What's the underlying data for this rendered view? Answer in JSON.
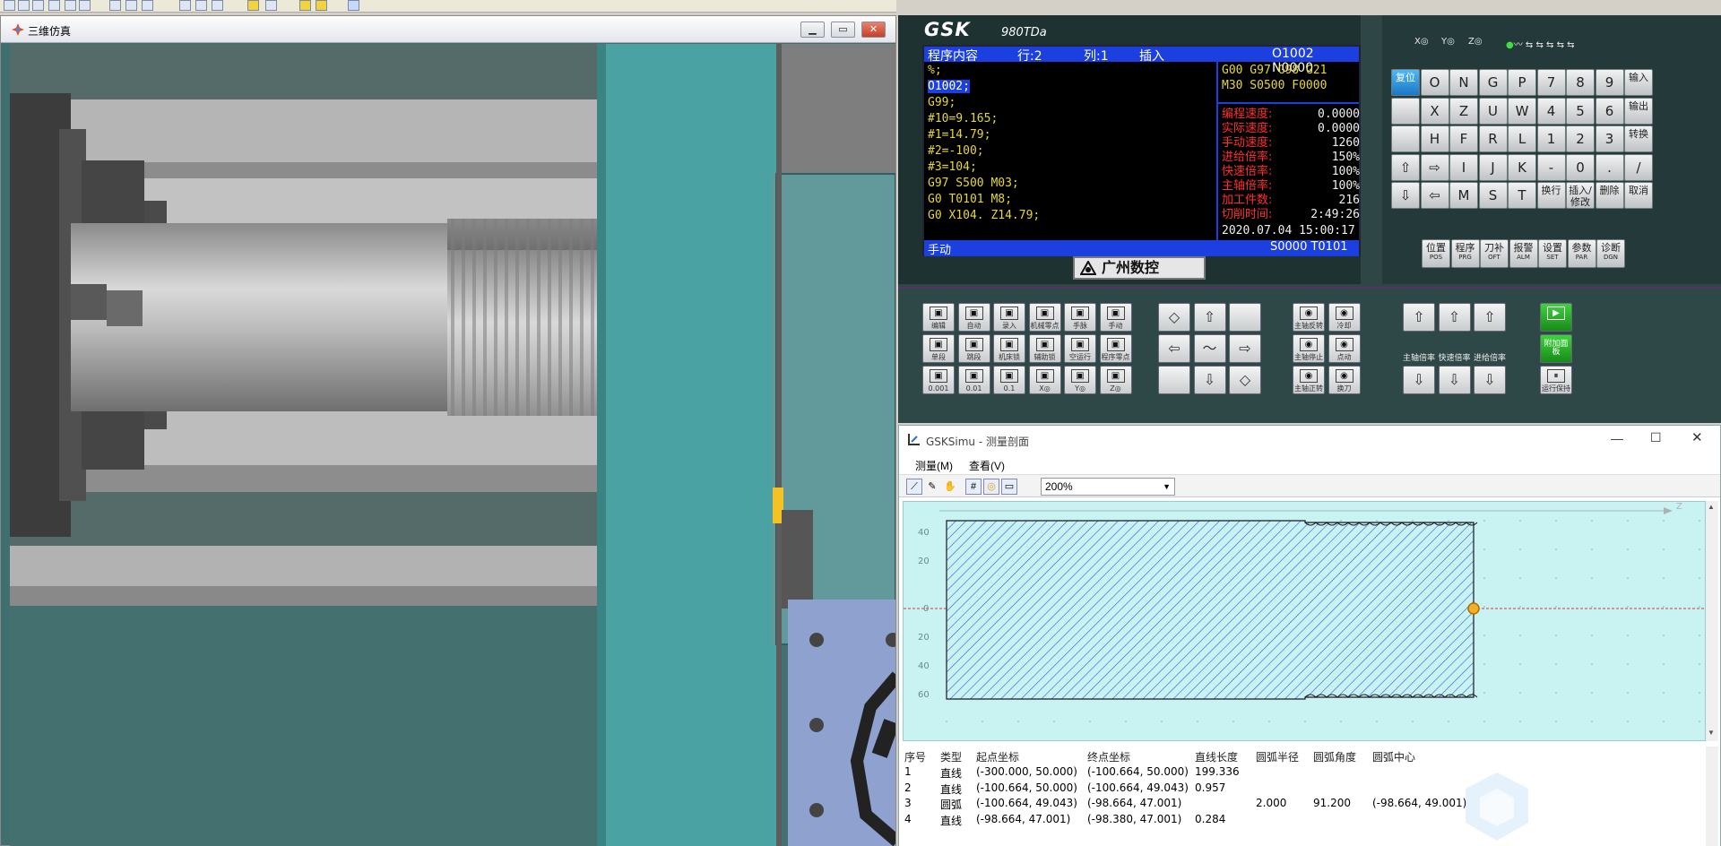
{
  "sim3d": {
    "title": "三维仿真"
  },
  "cnc": {
    "logo": "GSK",
    "model": "980TDa",
    "brand": "广州数控",
    "header": {
      "content": "程序内容",
      "row": "行:2",
      "col": "列:1",
      "mode": "插入",
      "program": "O1002 N0000"
    },
    "program_lines": [
      "%;",
      "O1002;",
      "G99;",
      "#10=9.165;",
      "#1=14.79;",
      "#2=-100;",
      "#3=104;",
      "G97 S500 M03;",
      "G0 T0101 M8;",
      "G0 X104. Z14.79;"
    ],
    "selected_line_index": 1,
    "mcodes": [
      "G00 G97 G98 G21",
      "M30 S0500 F0000"
    ],
    "status": [
      {
        "label": "编程速度:",
        "value": "0.0000"
      },
      {
        "label": "实际速度:",
        "value": "0.0000"
      },
      {
        "label": "手动速度:",
        "value": "1260"
      },
      {
        "label": "进给倍率:",
        "value": "150%"
      },
      {
        "label": "快速倍率:",
        "value": "100%"
      },
      {
        "label": "主轴倍率:",
        "value": "100%"
      },
      {
        "label": "加工件数:",
        "value": "216"
      },
      {
        "label": "切削时间:",
        "value": "2:49:26"
      }
    ],
    "datetime": "2020.07.04 15:00:17",
    "footer": {
      "mode": "手动",
      "spindle": "S0000 T0101"
    },
    "indicators": [
      "X◎",
      "Y◎",
      "Z◎"
    ],
    "keys": {
      "row1": [
        "复位",
        "O",
        "N",
        "G",
        "P",
        "7",
        "8",
        "9",
        "输入"
      ],
      "row2": [
        "",
        "X",
        "Z",
        "U",
        "W",
        "4",
        "5",
        "6",
        "输出"
      ],
      "row3": [
        "",
        "H",
        "F",
        "R",
        "L",
        "1",
        "2",
        "3",
        "转换"
      ],
      "row4": [
        "⇧",
        "⇨",
        "I",
        "J",
        "K",
        "-",
        "0",
        ".",
        "/"
      ],
      "row5": [
        "⇩",
        "⇦",
        "M",
        "S",
        "T",
        "换行",
        "插入/修改",
        "删除",
        "取消"
      ],
      "row6": [
        "位置",
        "程序",
        "刀补",
        "报警",
        "设置",
        "参数",
        "诊断"
      ],
      "row6_sub": [
        "POS",
        "PRG",
        "OFT",
        "ALM",
        "SET",
        "PAR",
        "DGN"
      ]
    },
    "ops": {
      "row1": [
        "编辑",
        "自动",
        "录入",
        "机械零点",
        "手脉",
        "手动"
      ],
      "row2": [
        "单段",
        "跳段",
        "机床锁",
        "辅助锁",
        "空运行",
        "程序零点"
      ],
      "row3": [
        "0.001",
        "0.01",
        "0.1",
        "X◎",
        "Y◎",
        "Z◎"
      ],
      "spindle": [
        "主轴反转",
        "冷却",
        "主轴停止",
        "点动",
        "主轴正转",
        "换刀"
      ],
      "override_labels": [
        "主轴倍率",
        "快速倍率",
        "进给倍率"
      ],
      "extra": [
        "附加面板",
        "运行保持"
      ]
    }
  },
  "measure": {
    "title": "GSKSimu - 测量剖面",
    "menu": [
      "测量(M)",
      "查看(V)"
    ],
    "zoom": "200%",
    "y_ticks": [
      "40",
      "20",
      "0",
      "20",
      "40",
      "60"
    ],
    "z_label": "Z",
    "table_headers": [
      "序号",
      "类型",
      "起点坐标",
      "终点坐标",
      "直线长度",
      "圆弧半径",
      "圆弧角度",
      "圆弧中心"
    ],
    "rows": [
      [
        "1",
        "直线",
        "(-300.000, 50.000)",
        "(-100.664, 50.000)",
        "199.336",
        "",
        "",
        ""
      ],
      [
        "2",
        "直线",
        "(-100.664, 50.000)",
        "(-100.664, 49.043)",
        "0.957",
        "",
        "",
        ""
      ],
      [
        "3",
        "圆弧",
        "(-100.664, 49.043)",
        "(-98.664, 47.001)",
        "",
        "2.000",
        "91.200",
        "(-98.664, 49.001)"
      ],
      [
        "4",
        "直线",
        "(-98.664, 47.001)",
        "(-98.380, 47.001)",
        "0.284",
        "",
        "",
        ""
      ]
    ]
  }
}
